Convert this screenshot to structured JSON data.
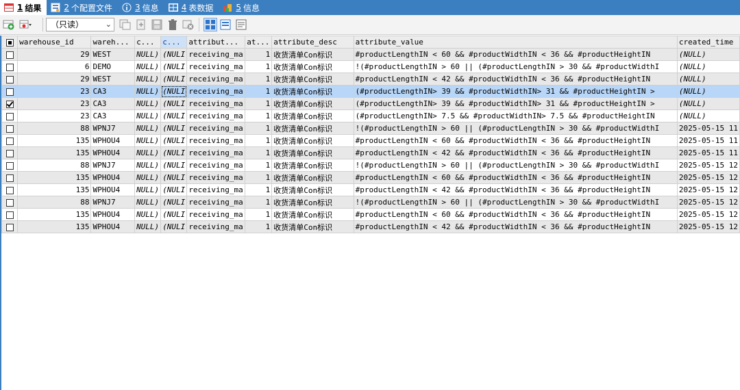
{
  "tabs": [
    {
      "num": "1",
      "label": "结果",
      "icon": "grid-result-icon",
      "active": true
    },
    {
      "num": "2",
      "label": "个配置文件",
      "icon": "profile-icon",
      "active": false
    },
    {
      "num": "3",
      "label": "信息",
      "icon": "info-icon",
      "active": false
    },
    {
      "num": "4",
      "label": "表数据",
      "icon": "table-data-icon",
      "active": false
    },
    {
      "num": "5",
      "label": "信息",
      "icon": "info2-icon",
      "active": false
    }
  ],
  "toolbar": {
    "readonly_label": "（只读）"
  },
  "columns": [
    "warehouse_id",
    "wareh...",
    "c...",
    "c...",
    "attribut...",
    "at...",
    "attribute_desc",
    "attribute_value",
    "created_time"
  ],
  "rows": [
    {
      "checked": false,
      "selected": false,
      "c": [
        "29",
        "WEST",
        "NULL)",
        "(NULI",
        "receiving_ma",
        "1",
        "收货清单Con标识",
        "#productLengthIN < 60  && #productWidthIN < 36 && #productHeightIN",
        "(NULL)"
      ]
    },
    {
      "checked": false,
      "selected": false,
      "c": [
        "6",
        "DEMO",
        "NULL)",
        "(NULI",
        "receiving_ma",
        "1",
        "收货清单Con标识",
        "!(#productLengthIN > 60 || (#productLengthIN > 30 && #productWidthI",
        "(NULL)"
      ]
    },
    {
      "checked": false,
      "selected": false,
      "c": [
        "29",
        "WEST",
        "NULL)",
        "(NULI",
        "receiving_ma",
        "1",
        "收货清单Con标识",
        "#productLengthIN < 42  && #productWidthIN < 36 && #productHeightIN",
        "(NULL)"
      ]
    },
    {
      "checked": false,
      "selected": true,
      "c": [
        "23",
        "CA3",
        "NULL)",
        "(NULI",
        "receiving_ma",
        "1",
        "收货清单Con标识",
        "(#productLengthIN> 39 &&  #productWidthIN> 31 && #productHeightIN >",
        "(NULL)"
      ]
    },
    {
      "checked": true,
      "selected": false,
      "c": [
        "23",
        "CA3",
        "NULL)",
        "(NULI",
        "receiving_ma",
        "1",
        "收货清单Con标识",
        "(#productLengthIN> 39 &&  #productWidthIN> 31 && #productHeightIN >",
        "(NULL)"
      ]
    },
    {
      "checked": false,
      "selected": false,
      "c": [
        "23",
        "CA3",
        "NULL)",
        "(NULI",
        "receiving_ma",
        "1",
        "收货清单Con标识",
        "(#productLengthIN> 7.5 &&  #productWidthIN> 7.5 && #productHeightIN",
        "(NULL)"
      ]
    },
    {
      "checked": false,
      "selected": false,
      "c": [
        "88",
        "WPNJ7",
        "NULL)",
        "(NULI",
        "receiving_ma",
        "1",
        "收货清单Con标识",
        "!(#productLengthIN > 60 || (#productLengthIN > 30 && #productWidthI",
        "2025-05-15 11"
      ]
    },
    {
      "checked": false,
      "selected": false,
      "c": [
        "135",
        "WPHOU4",
        "NULL)",
        "(NULI",
        "receiving_ma",
        "1",
        "收货清单Con标识",
        "#productLengthIN < 60  && #productWidthIN < 36 && #productHeightIN",
        "2025-05-15 11"
      ]
    },
    {
      "checked": false,
      "selected": false,
      "c": [
        "135",
        "WPHOU4",
        "NULL)",
        "(NULI",
        "receiving_ma",
        "1",
        "收货清单Con标识",
        "#productLengthIN < 42  && #productWidthIN < 36 && #productHeightIN",
        "2025-05-15 11"
      ]
    },
    {
      "checked": false,
      "selected": false,
      "c": [
        "88",
        "WPNJ7",
        "NULL)",
        "(NULI",
        "receiving_ma",
        "1",
        "收货清单Con标识",
        "!(#productLengthIN > 60 || (#productLengthIN > 30 && #productWidthI",
        "2025-05-15 12"
      ]
    },
    {
      "checked": false,
      "selected": false,
      "c": [
        "135",
        "WPHOU4",
        "NULL)",
        "(NULI",
        "receiving_ma",
        "1",
        "收货清单Con标识",
        "#productLengthIN < 60  && #productWidthIN < 36 && #productHeightIN",
        "2025-05-15 12"
      ]
    },
    {
      "checked": false,
      "selected": false,
      "c": [
        "135",
        "WPHOU4",
        "NULL)",
        "(NULI",
        "receiving_ma",
        "1",
        "收货清单Con标识",
        "#productLengthIN < 42  && #productWidthIN < 36 && #productHeightIN",
        "2025-05-15 12"
      ]
    },
    {
      "checked": false,
      "selected": false,
      "c": [
        "88",
        "WPNJ7",
        "NULL)",
        "(NULI",
        "receiving_ma",
        "1",
        "收货清单Con标识",
        "!(#productLengthIN > 60 || (#productLengthIN > 30 && #productWidthI",
        "2025-05-15 12"
      ]
    },
    {
      "checked": false,
      "selected": false,
      "c": [
        "135",
        "WPHOU4",
        "NULL)",
        "(NULI",
        "receiving_ma",
        "1",
        "收货清单Con标识",
        "#productLengthIN < 60  && #productWidthIN < 36 && #productHeightIN",
        "2025-05-15 12"
      ]
    },
    {
      "checked": false,
      "selected": false,
      "c": [
        "135",
        "WPHOU4",
        "NULL)",
        "(NULI",
        "receiving_ma",
        "1",
        "收货清单Con标识",
        "#productLengthIN < 42  && #productWidthIN < 36 && #productHeightIN",
        "2025-05-15 12"
      ]
    }
  ],
  "colors": {
    "tabbar": "#3c7fc1",
    "selected_row": "#b7d6f8",
    "odd_row": "#e8e8e8"
  }
}
